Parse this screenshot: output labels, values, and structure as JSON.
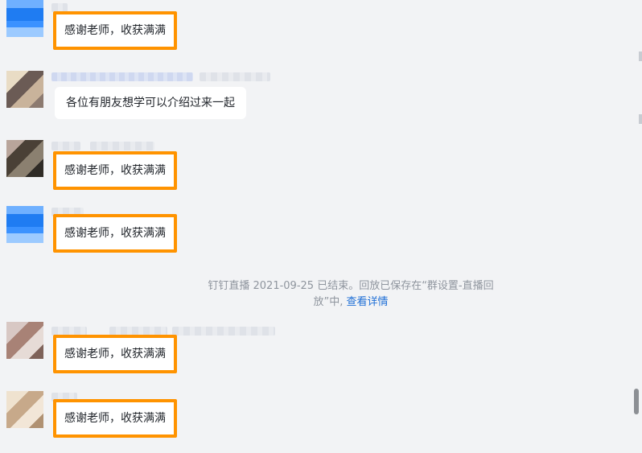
{
  "messages": [
    {
      "text": "感谢老师，收获满满"
    },
    {
      "text": "各位有朋友想学可以介绍过来一起"
    },
    {
      "text": "感谢老师，收获满满"
    },
    {
      "text": "感谢老师，收获满满"
    },
    {
      "text": "感谢老师，收获满满"
    },
    {
      "text": "感谢老师，收获满满"
    }
  ],
  "system_notice": {
    "prefix": "钉钉直播 2021-09-25 已结束。回放已保存在“群设置-直播回放”中,",
    "link": "查看详情"
  },
  "colors": {
    "highlight": "#ff9300",
    "link": "#1f6fd6",
    "background": "#f2f3f5"
  }
}
